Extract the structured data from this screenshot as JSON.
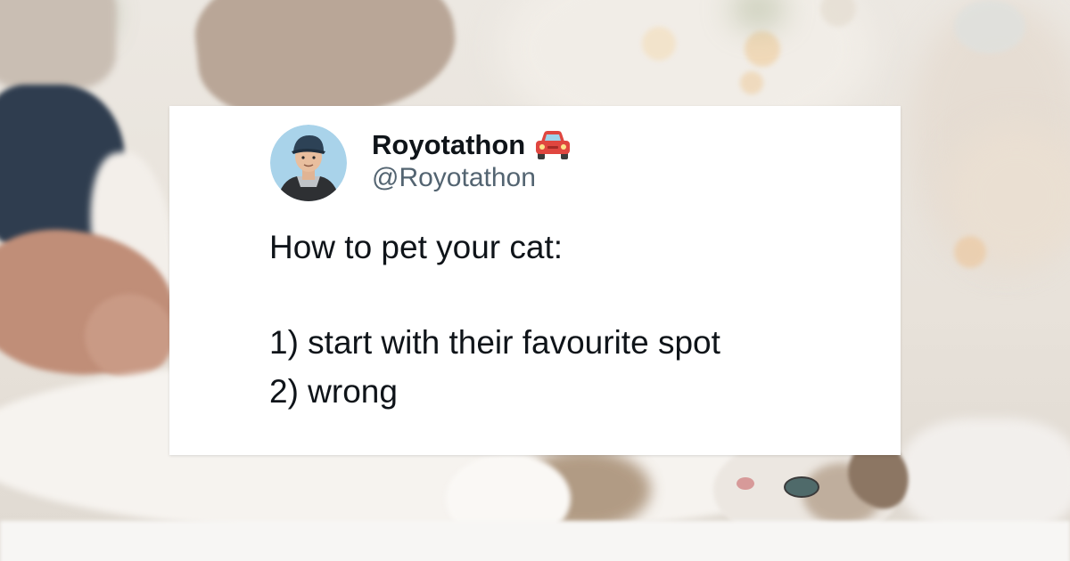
{
  "tweet": {
    "display_name": "Royotathon",
    "name_emoji": "red-car-icon",
    "handle": "@Royotathon",
    "lines": [
      "How to pet your cat:",
      "1) start with their favourite spot",
      "2) wrong"
    ]
  },
  "colors": {
    "text_primary": "#0f1419",
    "text_secondary": "#536471",
    "card_background": "#ffffff",
    "car_red": "#e0463f"
  },
  "background": {
    "description_icon": "photo-cat-being-petted"
  }
}
